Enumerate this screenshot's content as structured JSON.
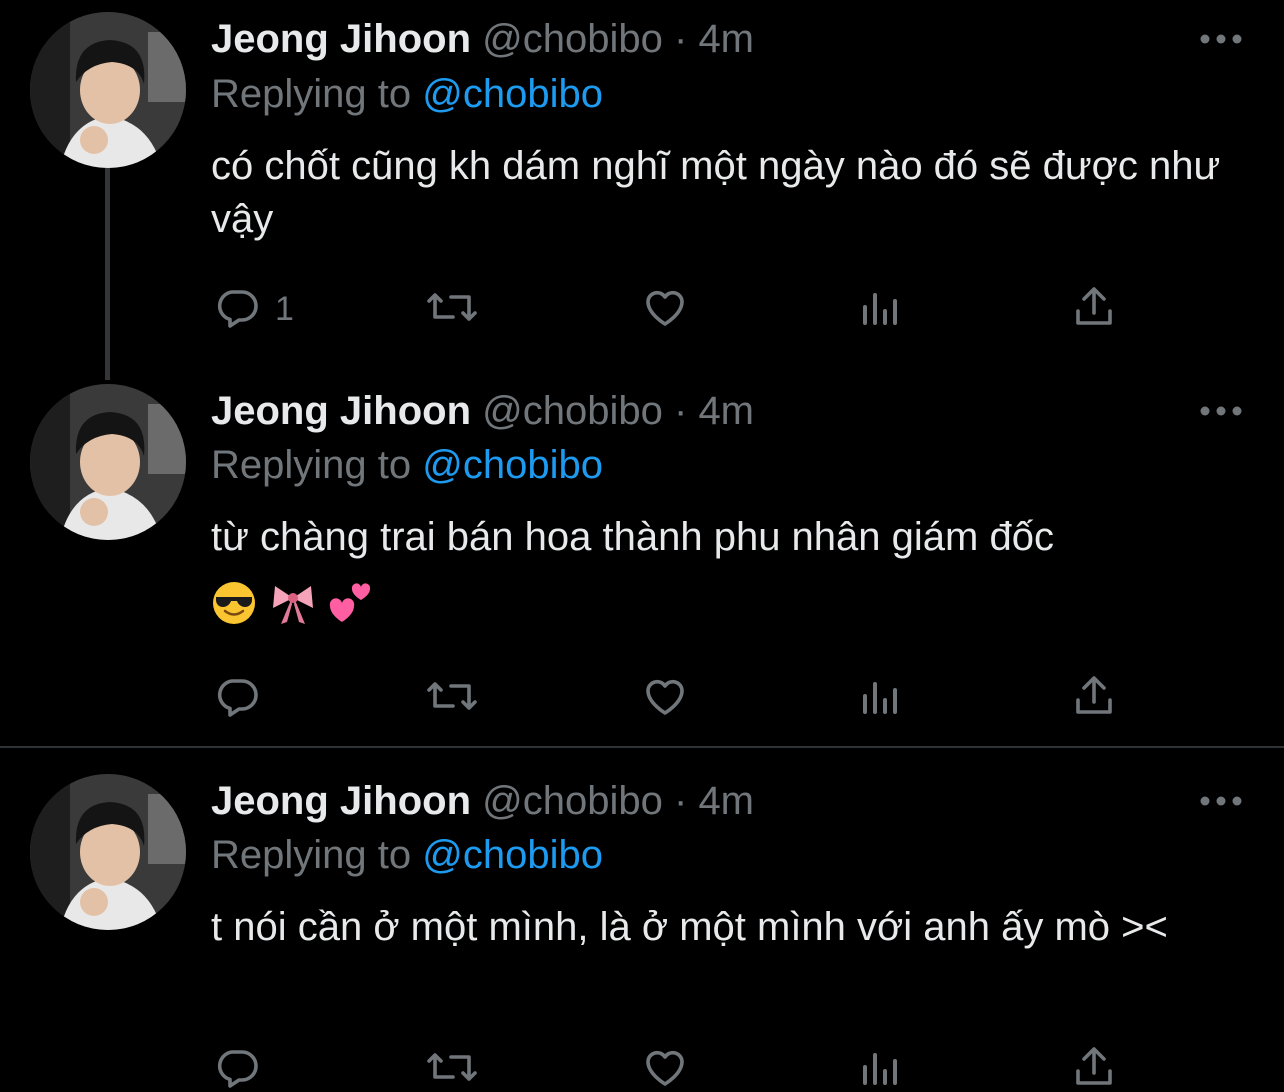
{
  "tweets": [
    {
      "name": "Jeong Jihoon",
      "handle": "@chobibo",
      "dot": "·",
      "time": "4m",
      "replying_prefix": "Replying to ",
      "replying_to": "@chobibo",
      "text": "có chốt cũng kh dám nghĩ một ngày nào đó sẽ được như vậy",
      "reply_count": "1"
    },
    {
      "name": "Jeong Jihoon",
      "handle": "@chobibo",
      "dot": "·",
      "time": "4m",
      "replying_prefix": "Replying to ",
      "replying_to": "@chobibo",
      "text": "từ chàng trai bán hoa thành phu nhân giám đốc",
      "emojis": [
        "😎",
        "🎀",
        "💕"
      ],
      "reply_count": ""
    },
    {
      "name": "Jeong Jihoon",
      "handle": "@chobibo",
      "dot": "·",
      "time": "4m",
      "replying_prefix": "Replying to ",
      "replying_to": "@chobibo",
      "text": "t nói cần ở một mình, là ở một mình với anh ấy mò ><",
      "reply_count": ""
    }
  ],
  "icons": {
    "reply": "reply-icon",
    "retweet": "retweet-icon",
    "like": "heart-icon",
    "views": "views-icon",
    "share": "share-icon",
    "more": "more-icon"
  },
  "colors": {
    "background": "#000000",
    "text": "#e7e9ea",
    "muted": "#71767b",
    "link": "#1d9bf0",
    "thread_line": "#333639",
    "separator": "#2f3336"
  }
}
